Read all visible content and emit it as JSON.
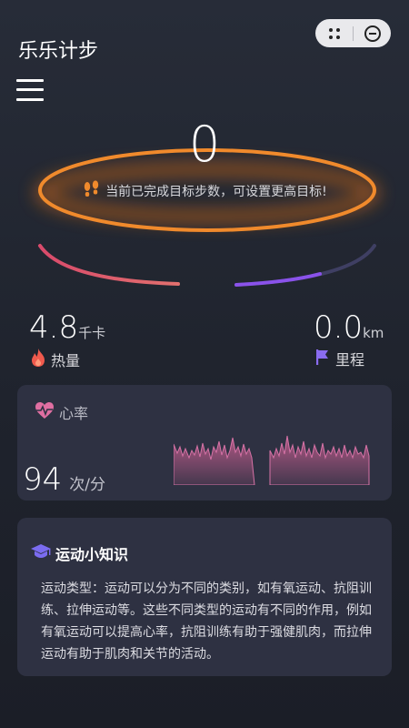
{
  "app_title": "乐乐计步",
  "icons": {
    "more": "more-dots-icon",
    "close": "close-circle-icon",
    "menu": "hamburger-menu-icon",
    "footprint": "footprint-icon",
    "flame": "flame-icon",
    "flag": "flag-icon",
    "heart": "heart-pulse-icon",
    "cap": "graduation-cap-icon"
  },
  "colors": {
    "ring": "#f08a2c",
    "calorie_arc": "#e0596f",
    "distance_arc": "#8a52ea",
    "flame": "#f05a4d",
    "flag": "#8a6cf0",
    "heart": "#e06fa2",
    "cap": "#7b6cf0"
  },
  "steps": {
    "value": "0",
    "goal_text": "当前已完成目标步数，可设置更高目标!"
  },
  "calories": {
    "value": "4.8",
    "unit": "千卡",
    "label": "热量"
  },
  "distance": {
    "value": "0.0",
    "unit": "km",
    "label": "里程"
  },
  "heart_rate": {
    "title": "心率",
    "value": "94",
    "unit": "次/分"
  },
  "tip": {
    "title": "运动小知识",
    "body": "运动类型：运动可以分为不同的类别，如有氧运动、抗阻训练、拉伸运动等。这些不同类型的运动有不同的作用，例如有氧运动可以提高心率，抗阻训练有助于强健肌肉，而拉伸运动有助于肌肉和关节的活动。"
  }
}
